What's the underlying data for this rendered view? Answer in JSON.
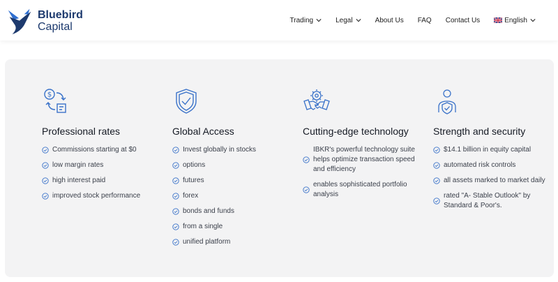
{
  "brand": {
    "line1": "Bluebird",
    "line2": "Capital",
    "color": "#1d3a6e"
  },
  "nav": [
    {
      "label": "Trading",
      "dropdown": true
    },
    {
      "label": "Legal",
      "dropdown": true
    },
    {
      "label": "About Us",
      "dropdown": false
    },
    {
      "label": "FAQ",
      "dropdown": false
    },
    {
      "label": "Contact Us",
      "dropdown": false
    },
    {
      "label": "English",
      "dropdown": true,
      "flag": "uk-flag-icon"
    }
  ],
  "accent": "#3a72c9",
  "features": [
    {
      "icon": "dollar-exchange-icon",
      "title": "Professional rates",
      "items": [
        "Commissions starting at $0",
        "low margin rates",
        "high interest paid",
        "improved stock performance"
      ]
    },
    {
      "icon": "shield-check-icon",
      "title": "Global Access",
      "items": [
        "Invest globally in stocks",
        "options",
        "futures",
        "forex",
        "bonds and funds",
        "from a single",
        "unified platform"
      ]
    },
    {
      "icon": "handshake-gear-icon",
      "title": "Cutting-edge technology",
      "items": [
        "IBKR's powerful technology suite helps optimize transaction speed and efficiency",
        "enables sophisticated portfolio analysis"
      ]
    },
    {
      "icon": "user-shield-icon",
      "title": "Strength and security",
      "items": [
        "$14.1 billion in equity capital",
        "automated risk controls",
        "all assets marked to market daily",
        "rated \"A- Stable Outlook\" by Standard & Poor's."
      ]
    }
  ]
}
